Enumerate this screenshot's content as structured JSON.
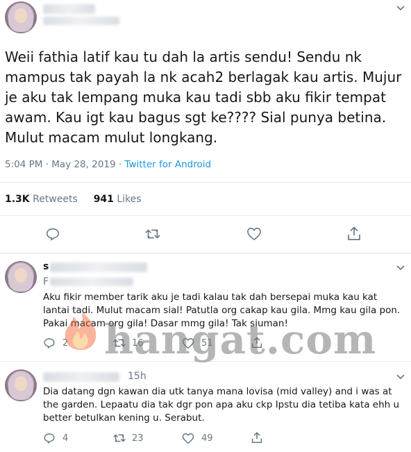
{
  "main_tweet": {
    "text": "Weii fathia latif kau tu dah la artis sendu! Sendu nk mampus tak payah la nk acah2 berlagak kau artis. Mujur je aku tak lempang muka kau tadi sbb aku fikir tempat awam. Kau igt kau bagus sgt ke???? Sial punya betina. Mulut macam mulut longkang.",
    "time": "5:04 PM · May 28, 2019 · ",
    "client": "Twitter for Android",
    "retweets_count": "1.3K",
    "retweets_label": "Retweets",
    "likes_count": "941",
    "likes_label": "Likes"
  },
  "replies": [
    {
      "name_initial": "s",
      "handle_initial": "F",
      "text": "Aku fikir member tarik aku je tadi kalau tak dah bersepai muka kau kat lantai tadi. Mulut macam sial! Patutla org cakap kau gila. Mmg kau gila pon. Pakai macam org gila! Dasar mmg gila! Tak siuman!",
      "reply_count": "2",
      "retweet_count": "16",
      "like_count": "51"
    },
    {
      "time": "15h",
      "text": "Dia datang dgn kawan dia utk tanya mana lovisa (mid valley) and i was at the garden. Lepaatu dia tak dgr pon apa aku ckp Ipstu dia tetiba kata ehh u better betulkan kening u. Serabut.",
      "reply_count": "4",
      "retweet_count": "23",
      "like_count": "49"
    }
  ],
  "watermark": "hangat.com",
  "colors": {
    "link": "#1b95e0",
    "secondary": "#657786",
    "divider": "#e6ecf0"
  }
}
